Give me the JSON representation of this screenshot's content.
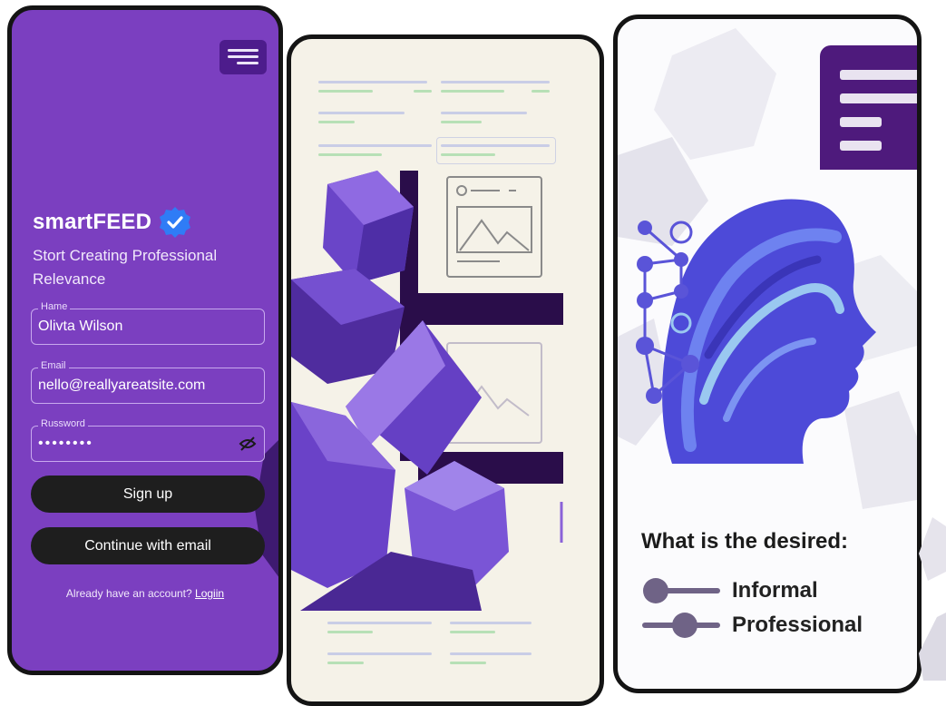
{
  "signup": {
    "brand": "smartFEED",
    "tagline": "Stort Creating Professional Relevance",
    "name_label": "Hame",
    "name_value": "Olivta Wilson",
    "email_label": "Email",
    "email_value": "nello@reallyareatsite.com",
    "password_label": "Russword",
    "password_value": "••••••••",
    "signup_button": "Sign up",
    "continue_button": "Continue with email",
    "already_text": "Already have an account?",
    "login_link": "Logiin",
    "colors": {
      "background": "#7b3fc0",
      "menu": "#4d1c8c",
      "button": "#1e1e1e",
      "verified": "#2f7cf6"
    }
  },
  "feed": {
    "colors": {
      "background": "#f5f2e8",
      "bar": "#2a0d4a",
      "block": "#8a62d8"
    }
  },
  "tone": {
    "question": "What is the desired:",
    "options": [
      {
        "label": "Informal"
      },
      {
        "label": "Professional"
      }
    ],
    "colors": {
      "menu": "#4e1a7c",
      "slider": "#6f6386",
      "head": "#4d4ad8"
    }
  }
}
